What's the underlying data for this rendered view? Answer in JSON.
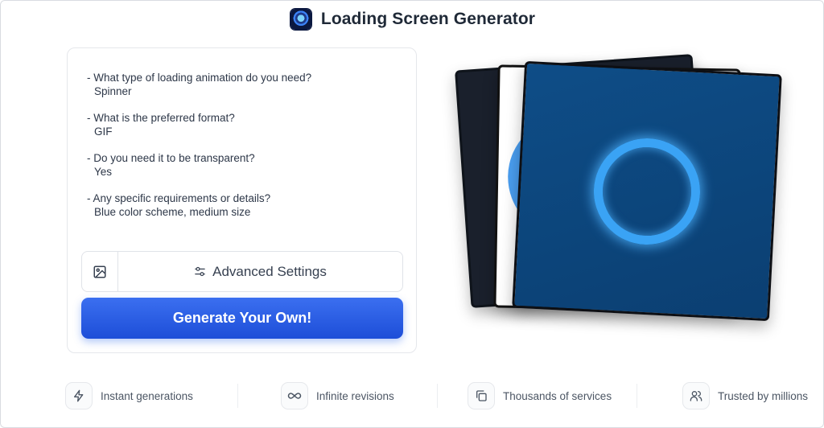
{
  "header": {
    "logo_icon": "app-logo-icon",
    "title": "Loading Screen Generator"
  },
  "form": {
    "questions": [
      {
        "q": "- What type of loading animation do you need?",
        "a": "Spinner"
      },
      {
        "q": "- What is the preferred format?",
        "a": "GIF"
      },
      {
        "q": "- Do you need it to be transparent?",
        "a": "Yes"
      },
      {
        "q": "- Any specific requirements or details?",
        "a": "Blue color scheme, medium size"
      }
    ],
    "image_icon": "image-icon",
    "settings_icon": "sliders-icon",
    "advanced_label": "Advanced Settings",
    "generate_label": "Generate Your Own!",
    "accent_color": "#2563eb"
  },
  "preview": {
    "cards": [
      "dark-card",
      "white-card",
      "blue-spinner-card"
    ],
    "ring_color": "#3aa3f5",
    "card_color": "#0e4d87"
  },
  "features": [
    {
      "icon": "lightning-icon",
      "label": "Instant generations"
    },
    {
      "icon": "infinity-icon",
      "label": "Infinite revisions"
    },
    {
      "icon": "copy-icon",
      "label": "Thousands of services"
    },
    {
      "icon": "users-icon",
      "label": "Trusted by millions"
    }
  ]
}
